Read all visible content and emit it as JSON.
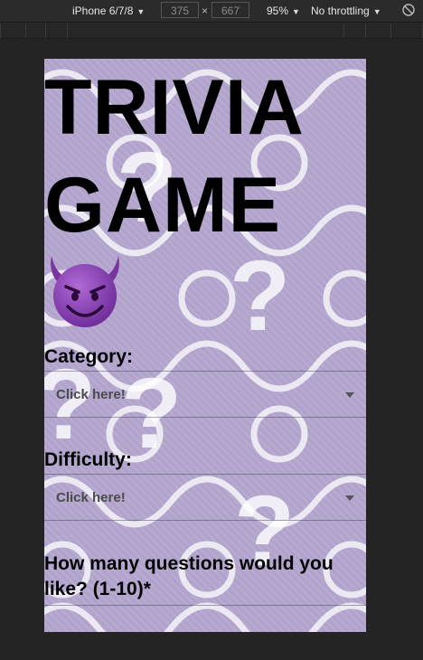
{
  "devtools": {
    "device": "iPhone 6/7/8",
    "width": "375",
    "times": "×",
    "height": "667",
    "zoom": "95%",
    "throttling": "No throttling",
    "caret": "▼",
    "icons": {
      "rotate": "rotate-icon"
    }
  },
  "page": {
    "title_line1": "TRIVIA",
    "title_line2": "GAME",
    "emoji": "smiling-face-with-horns-emoji",
    "category_label": "Category:",
    "category_placeholder": "Click here!",
    "difficulty_label": "Difficulty:",
    "difficulty_placeholder": "Click here!",
    "count_label": "How many questions would you like? (1-10)*"
  },
  "colors": {
    "background_purple": "#b1a3cc",
    "devil_purple": "#8a3fb3",
    "devtools_bg": "#2b2b2b"
  }
}
